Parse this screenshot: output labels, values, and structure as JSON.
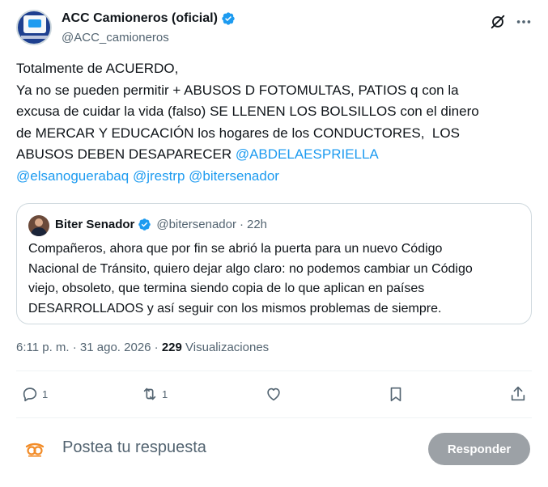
{
  "tweet": {
    "author": {
      "display_name": "ACC Camioneros (oficial)",
      "handle": "@ACC_camioneros",
      "verified_icon": "verified-badge-icon"
    },
    "text_lines": {
      "line1": "Totalmente de ACUERDO,",
      "line2": "Ya no se pueden permitir + ABUSOS D FOTOMULTAS, PATIOS q con la",
      "line3": "excusa de cuidar la vida (falso) SE LLENEN LOS BOLSILLOS con el dinero",
      "line4": "de MERCAR Y EDUCACIÓN los hogares de los CONDUCTORES,  LOS",
      "line5": "ABUSOS DEBEN DESAPARECER "
    },
    "mentions": [
      "@ABDELAESPRIELLA",
      "@elsanoguerabaq",
      "@jrestrp",
      "@bitersenador"
    ],
    "timestamp": "6:11 p. m. · 31 ago. 2026 · ",
    "views_count": "229",
    "views_label": " Visualizaciones",
    "icons": {
      "grok": "grok-icon",
      "more": "more-icon"
    },
    "colors": {
      "accent": "#1d9bf0",
      "muted": "#536471",
      "text": "#0f1419"
    }
  },
  "quote": {
    "display_name": "Biter Senador",
    "handle": "@bitersenador",
    "separator": " · ",
    "time": "22h",
    "lines": {
      "l1": "Compañeros, ahora que por fin se abrió la puerta para un nuevo Código",
      "l2": "Nacional de Tránsito, quiero dejar algo claro: no podemos cambiar un Código",
      "l3": "viejo, obsoleto, que termina siendo copia de lo que aplican en países",
      "l4": "DESARROLLADOS y así seguir con los mismos problemas de siempre."
    }
  },
  "actions": {
    "reply_count": "1",
    "retweet_count": "1",
    "icons": [
      "reply-icon",
      "retweet-icon",
      "like-icon",
      "bookmark-icon",
      "share-icon"
    ]
  },
  "composer": {
    "placeholder": "Postea tu respuesta",
    "button_label": "Responder"
  }
}
